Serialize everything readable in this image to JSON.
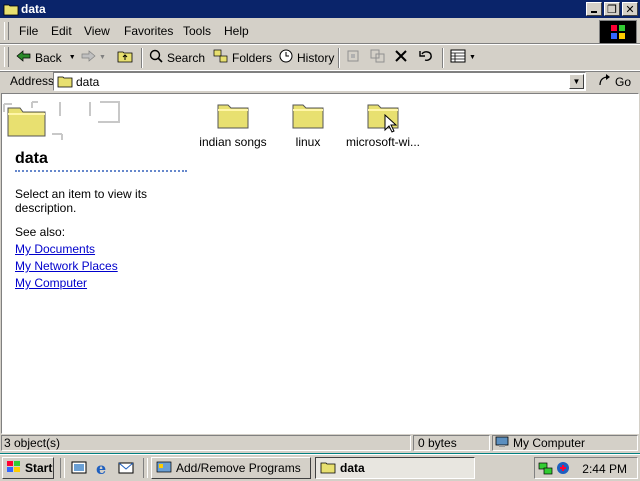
{
  "window": {
    "title": "data",
    "controls": [
      "minimize",
      "maximize",
      "close"
    ]
  },
  "menu": [
    "File",
    "Edit",
    "View",
    "Favorites",
    "Tools",
    "Help"
  ],
  "toolbar": {
    "back": "Back",
    "search": "Search",
    "folders": "Folders",
    "history": "History"
  },
  "address": {
    "label": "Address",
    "value": "data",
    "go": "Go"
  },
  "left_pane": {
    "title": "data",
    "description": "Select an item to view its description.",
    "see_also": "See also:",
    "links": [
      "My Documents",
      "My Network Places",
      "My Computer"
    ]
  },
  "folders": [
    {
      "label": "indian songs"
    },
    {
      "label": "linux"
    },
    {
      "label": "microsoft-wi..."
    }
  ],
  "status": {
    "objects": "3 object(s)",
    "size": "0 bytes",
    "zone": "My Computer"
  },
  "taskbar": {
    "start": "Start",
    "tasks": [
      {
        "label": "Add/Remove Programs",
        "active": false
      },
      {
        "label": "data",
        "active": true
      }
    ],
    "clock": "2:44 PM"
  },
  "colors": {
    "title_bar": "#0a246a",
    "face": "#d4d0c8",
    "link": "#0000cc",
    "folder": "#e8e070"
  }
}
